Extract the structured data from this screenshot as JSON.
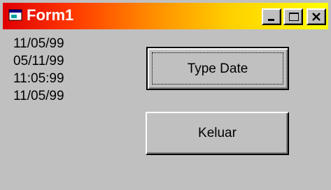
{
  "window": {
    "title": "Form1",
    "minimize_glyph": "_",
    "maximize_glyph": "□",
    "close_glyph": "×",
    "titlebar_gradient": [
      "#e00000",
      "#ffff00"
    ]
  },
  "main": {
    "date_lines": [
      "11/05/99",
      "05/11/99",
      "11:05:99",
      "11/05/99"
    ],
    "type_date_button": "Type Date",
    "keluar_button": "Keluar"
  },
  "icons": {
    "app": "form-window-icon",
    "minimize": "minimize-icon",
    "maximize": "maximize-icon",
    "close": "close-icon"
  }
}
